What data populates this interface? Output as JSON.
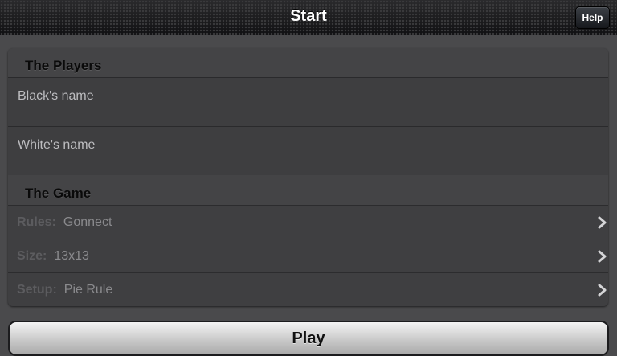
{
  "navbar": {
    "title": "Start",
    "help_label": "Help"
  },
  "players": {
    "header": "The Players",
    "black_placeholder": "Black's name",
    "white_placeholder": "White's name"
  },
  "game": {
    "header": "The Game",
    "rows": [
      {
        "label": "Rules:",
        "value": "Gonnect"
      },
      {
        "label": "Size:",
        "value": "13x13"
      },
      {
        "label": "Setup:",
        "value": "Pie Rule"
      }
    ]
  },
  "play_label": "Play"
}
